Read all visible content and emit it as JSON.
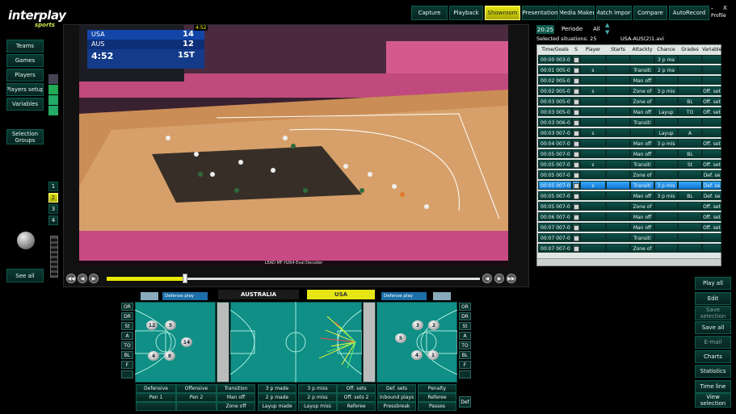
{
  "brand": {
    "name": "interplay",
    "sub": "sports"
  },
  "topnav": [
    {
      "label": "Capture"
    },
    {
      "label": "Playback"
    },
    {
      "label": "Showroom"
    },
    {
      "label": "Presentation"
    },
    {
      "label": "Media Maker"
    },
    {
      "label": "Match Import"
    },
    {
      "label": "Compare"
    },
    {
      "label": "AutoRecord"
    }
  ],
  "window": {
    "minimize": "-",
    "close": "X",
    "profile": "Profile"
  },
  "leftnav": [
    {
      "label": "Teams"
    },
    {
      "label": "Games"
    },
    {
      "label": "Players"
    },
    {
      "label": "Players setup"
    },
    {
      "label": "Variables"
    }
  ],
  "selection_groups": "Selection Groups",
  "see_all": "See all",
  "periods": [
    "1",
    "2",
    "3",
    "4"
  ],
  "video": {
    "scoreboard": {
      "team1": "USA",
      "score1": "14",
      "team2": "AUS",
      "score2": "12",
      "clock": "4:52",
      "quarter": "1ST",
      "shot": "4:52"
    },
    "decoder_caption": "LEAD MF H264 Eval Decoder",
    "progress": 0.21
  },
  "playlist": {
    "time": "20:25",
    "periode_label": "Periode",
    "periode_value": "All",
    "selected_label": "Selected situations: 25",
    "file": "USA-AUS(2)1.avi",
    "columns": [
      "Time/Goals",
      "S",
      "Player",
      "Starts",
      "Attackty",
      "Chance",
      "Grades",
      "Variable"
    ],
    "rows": [
      {
        "time": "00:00",
        "goals": "003-0",
        "player": "",
        "starts": "",
        "attack": "",
        "chance": "3 p ma",
        "grade": "",
        "var": ""
      },
      {
        "time": "00:01",
        "goals": "005-0",
        "player": "s",
        "starts": "",
        "attack": "Transiti",
        "chance": "2 p ma",
        "grade": "",
        "var": ""
      },
      {
        "time": "00:02",
        "goals": "005-0",
        "player": "",
        "starts": "",
        "attack": "Man off",
        "chance": "",
        "grade": "",
        "var": ""
      },
      {
        "time": "00:02",
        "goals": "005-0",
        "player": "s",
        "starts": "",
        "attack": "Zone of",
        "chance": "3 p mis",
        "grade": "",
        "var": "Off. set"
      },
      {
        "time": "00:03",
        "goals": "005-0",
        "player": "",
        "starts": "",
        "attack": "Zone of",
        "chance": "",
        "grade": "BL",
        "var": "Off. set"
      },
      {
        "time": "00:03",
        "goals": "005-0",
        "player": "",
        "starts": "",
        "attack": "Man off",
        "chance": "Layup",
        "grade": "TO",
        "var": "Off. set"
      },
      {
        "time": "00:03",
        "goals": "006-0",
        "player": "",
        "starts": "",
        "attack": "Transiti",
        "chance": "",
        "grade": "",
        "var": ""
      },
      {
        "time": "00:03",
        "goals": "007-0",
        "player": "s",
        "starts": "",
        "attack": "",
        "chance": "Layup",
        "grade": "A",
        "var": ""
      },
      {
        "time": "00:04",
        "goals": "007-0",
        "player": "",
        "starts": "",
        "attack": "Man off",
        "chance": "3 p mis",
        "grade": "",
        "var": "Off. set"
      },
      {
        "time": "00:05",
        "goals": "007-0",
        "player": "",
        "starts": "",
        "attack": "Man off",
        "chance": "",
        "grade": "BL",
        "var": ""
      },
      {
        "time": "00:05",
        "goals": "007-0",
        "player": "s",
        "starts": "",
        "attack": "Transiti",
        "chance": "",
        "grade": "St",
        "var": "Off. set"
      },
      {
        "time": "00:05",
        "goals": "007-0",
        "player": "",
        "starts": "",
        "attack": "Zone of",
        "chance": "",
        "grade": "",
        "var": "Def. se"
      },
      {
        "time": "00:05",
        "goals": "007-0",
        "player": "s",
        "starts": "",
        "attack": "Transiti",
        "chance": "3 p mis",
        "grade": "",
        "var": "Def. se",
        "selected": true
      },
      {
        "time": "00:05",
        "goals": "007-0",
        "player": "",
        "starts": "",
        "attack": "Man off",
        "chance": "3 p mis",
        "grade": "BL",
        "var": "Def. se"
      },
      {
        "time": "00:05",
        "goals": "007-0",
        "player": "",
        "starts": "",
        "attack": "Zone of",
        "chance": "",
        "grade": "",
        "var": "Off. set"
      },
      {
        "time": "00:06",
        "goals": "007-0",
        "player": "",
        "starts": "",
        "attack": "Man off",
        "chance": "",
        "grade": "",
        "var": "Off. set"
      },
      {
        "time": "00:07",
        "goals": "007-0",
        "player": "",
        "starts": "",
        "attack": "Man off",
        "chance": "",
        "grade": "",
        "var": "Off. set"
      },
      {
        "time": "00:07",
        "goals": "007-0",
        "player": "",
        "starts": "",
        "attack": "Transiti",
        "chance": "",
        "grade": "",
        "var": ""
      },
      {
        "time": "00:07",
        "goals": "007-0",
        "player": "",
        "starts": "",
        "attack": "Zone of",
        "chance": "",
        "grade": "",
        "var": ""
      }
    ]
  },
  "right_actions": [
    {
      "label": "Play all",
      "dim": false
    },
    {
      "label": "Edit",
      "dim": false
    },
    {
      "label": "Save selection",
      "dim": true
    },
    {
      "label": "Save all",
      "dim": false
    },
    {
      "label": "E-mail",
      "dim": true
    },
    {
      "label": "Charts",
      "dim": false
    },
    {
      "label": "Statistics",
      "dim": false
    },
    {
      "label": "Time line",
      "dim": false
    },
    {
      "label": "View selection",
      "dim": false
    }
  ],
  "bottom": {
    "team_left": "AUSTRALIA",
    "team_right": "USA",
    "left_select": "Defense play",
    "right_select": "Defense play",
    "side_labels": [
      "OR",
      "DR",
      "St",
      "A",
      "TO",
      "BL",
      "F",
      ""
    ],
    "right_side_labels": [
      "OR",
      "DR",
      "St",
      "A",
      "TO",
      "BL",
      "F",
      ""
    ],
    "def_label": "Def",
    "left_players": [
      "12",
      "5",
      "14",
      "4",
      "8"
    ],
    "right_players": [
      "3",
      "2",
      "5",
      "4",
      "1"
    ],
    "grid": [
      [
        "Defensive",
        "Offensive",
        "Transition",
        "3 p made",
        "3 p miss",
        "Off. sets",
        "Def. sets",
        "Penalty"
      ],
      [
        "Pen 1",
        "Pen 2",
        "Man off",
        "2 p made",
        "2 p miss",
        "Off. sets 2",
        "Inbound plays",
        "Referee"
      ],
      [
        "",
        "",
        "Zone off",
        "Layup made",
        "Layup miss",
        "Referee",
        "Pressbreak",
        "Passes"
      ]
    ]
  },
  "colors": {
    "accent_yellow": "#e6e616",
    "teal": "#0f8f86",
    "selected_row": "#1e88e5"
  }
}
